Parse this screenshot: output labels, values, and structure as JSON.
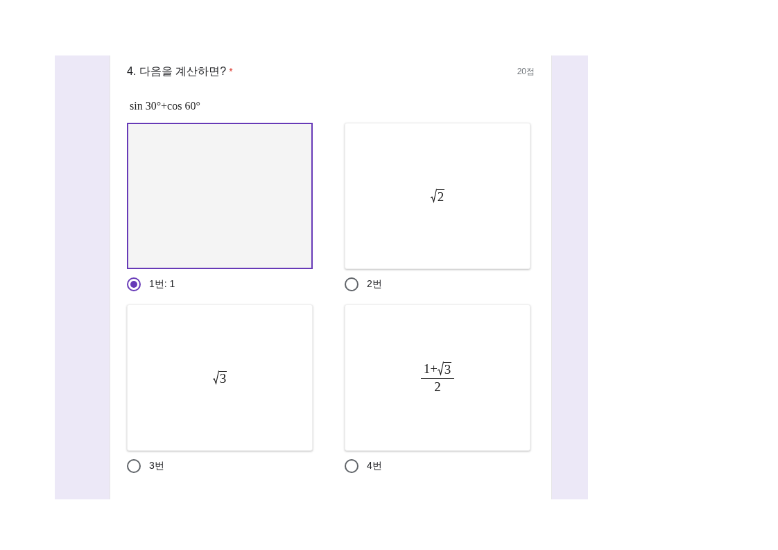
{
  "question": {
    "number_title": "4. 다음을 계산하면?",
    "required_mark": "*",
    "points": "20점",
    "formula": "sin 30°+cos 60°"
  },
  "options": [
    {
      "label": "1번: 1",
      "selected": true,
      "image": {
        "kind": "blank"
      }
    },
    {
      "label": "2번",
      "selected": false,
      "image": {
        "kind": "sqrt",
        "radicand": "2"
      }
    },
    {
      "label": "3번",
      "selected": false,
      "image": {
        "kind": "sqrt",
        "radicand": "3"
      }
    },
    {
      "label": "4번",
      "selected": false,
      "image": {
        "kind": "fraction",
        "numerator_prefix": "1+",
        "radicand": "3",
        "denominator": "2"
      }
    }
  ]
}
